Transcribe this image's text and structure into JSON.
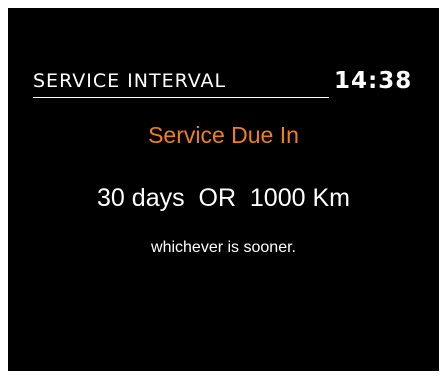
{
  "header": {
    "title": "SERVICE INTERVAL",
    "clock": "14:38"
  },
  "main": {
    "heading": "Service Due In",
    "days": "30 days",
    "separator": "OR",
    "distance": "1000 Km",
    "note": "whichever is sooner."
  },
  "colors": {
    "background": "#000000",
    "accent": "#f07f1a",
    "text": "#ffffff"
  }
}
